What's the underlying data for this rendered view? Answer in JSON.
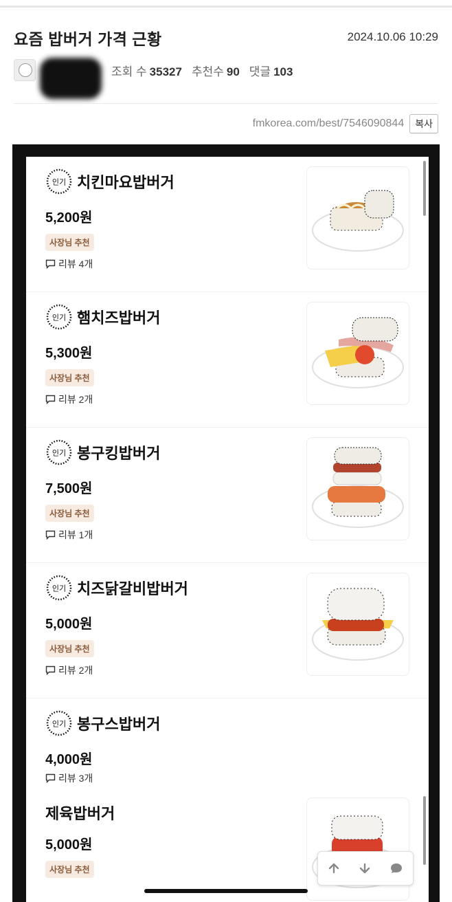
{
  "post": {
    "title": "요즘 밥버거 가격 근황",
    "date": "2024.10.06 10:29",
    "views_label": "조회 수",
    "views": "35327",
    "recs_label": "추천수",
    "recs": "90",
    "comments_label": "댓글",
    "comments": "103",
    "url": "fmkorea.com/best/7546090844",
    "copy_label": "복사"
  },
  "menu": {
    "badge_text": "인기",
    "items": [
      {
        "name": "치킨마요밥버거",
        "price": "5,200원",
        "tag": "사장님 추천",
        "review": "리뷰 4개"
      },
      {
        "name": "햄치즈밥버거",
        "price": "5,300원",
        "tag": "사장님 추천",
        "review": "리뷰 2개"
      },
      {
        "name": "봉구킹밥버거",
        "price": "7,500원",
        "tag": "사장님 추천",
        "review": "리뷰 1개"
      },
      {
        "name": "치즈닭갈비밥버거",
        "price": "5,000원",
        "tag": "사장님 추천",
        "review": "리뷰 2개"
      },
      {
        "name": "봉구스밥버거",
        "price": "4,000원",
        "review": "리뷰 3개"
      },
      {
        "name": "제육밥버거",
        "price": "5,000원",
        "tag": "사장님 추천"
      }
    ]
  },
  "icons": {
    "avatar": "avatar-icon",
    "review": "speech-bubble-icon",
    "up": "arrow-up-icon",
    "down": "arrow-down-icon",
    "comment": "comment-icon"
  }
}
